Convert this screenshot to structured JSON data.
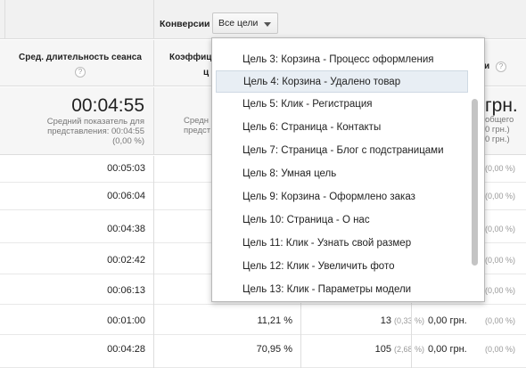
{
  "toolbar": {
    "conversions_label": "Конверсии",
    "conversions_select": "Все цели"
  },
  "columns": {
    "avg_session": "Сред. длительность сеанса",
    "conv_rate_partial": "Коэффиц",
    "conv_rate_partial2": "ц",
    "value_partial": "и"
  },
  "summary": {
    "avg_session_value": "00:04:55",
    "avg_session_sub1": "Средний показатель для",
    "avg_session_sub2": "представления: 00:04:55",
    "avg_session_sub3": "(0,00 %)",
    "rate_sub1": "Средн",
    "rate_sub2": "предст",
    "value_big": "грн.",
    "value_sub1": "общего",
    "value_sub2": "0 грн.)",
    "value_sub3": "0 грн.)"
  },
  "rows": [
    {
      "time": "00:05:03",
      "pct": "",
      "count": "",
      "count_pct": "",
      "money": "",
      "money_pct": "(0,00 %)"
    },
    {
      "time": "00:06:04",
      "pct": "",
      "count": "",
      "count_pct": "",
      "money": "",
      "money_pct": "(0,00 %)"
    },
    {
      "time": "00:04:38",
      "pct": "",
      "count": "",
      "count_pct": "",
      "money": "",
      "money_pct": "(0,00 %)"
    },
    {
      "time": "00:02:42",
      "pct": "",
      "count": "",
      "count_pct": "",
      "money": "",
      "money_pct": "(0,00 %)"
    },
    {
      "time": "00:06:13",
      "pct": "",
      "count": "",
      "count_pct": "",
      "money": "",
      "money_pct": "(0,00 %)"
    },
    {
      "time": "00:01:00",
      "pct": "11,21 %",
      "count": "13",
      "count_pct": "(0,33 %)",
      "money": "0,00 грн.",
      "money_pct": "(0,00 %)"
    },
    {
      "time": "00:04:28",
      "pct": "70,95 %",
      "count": "105",
      "count_pct": "(2,68 %)",
      "money": "0,00 грн.",
      "money_pct": "(0,00 %)"
    }
  ],
  "dropdown": {
    "items": [
      "Цель 3: Корзина - Процесс оформления",
      "Цель 4: Корзина - Удалено товар",
      "Цель 5: Клик - Регистрация",
      "Цель 6: Страница - Контакты",
      "Цель 7: Страница - Блог с подстраницами",
      "Цель 8: Умная цель",
      "Цель 9: Корзина - Оформлено заказ",
      "Цель 10: Страница - О нас",
      "Цель 11: Клик - Узнать свой размер",
      "Цель 12: Клик - Увеличить фото",
      "Цель 13: Клик - Параметры модели"
    ],
    "highlighted_index": 1
  },
  "icons": {
    "help": "question-mark-icon",
    "caret": "caret-down-icon"
  }
}
